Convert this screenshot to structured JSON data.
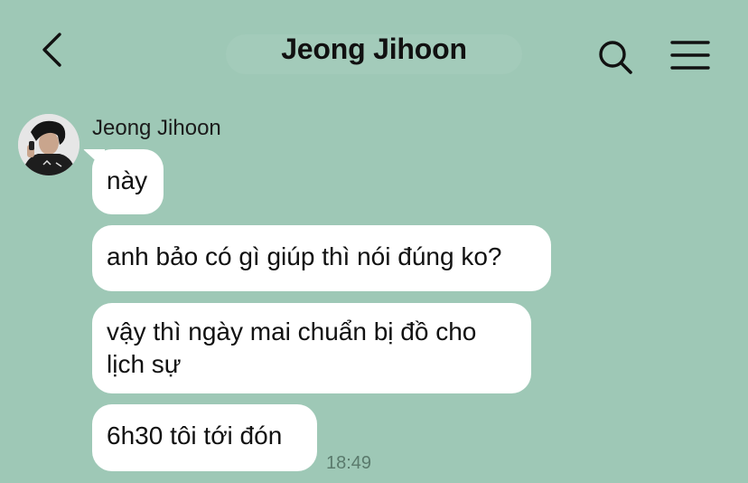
{
  "header": {
    "title": "Jeong Jihoon",
    "back_icon": "chevron-left-icon",
    "search_icon": "search-icon",
    "menu_icon": "hamburger-menu-icon"
  },
  "chat": {
    "sender_name": "Jeong Jihoon",
    "messages": [
      {
        "text": "này"
      },
      {
        "text": "anh bảo có gì giúp thì nói đúng ko?"
      },
      {
        "text": "vậy thì ngày mai chuẩn bị đồ cho lịch sự"
      },
      {
        "text": "6h30 tôi tới đón"
      }
    ],
    "last_time": "18:49"
  },
  "colors": {
    "background": "#9ec8b6",
    "bubble": "#ffffff",
    "text": "#111111",
    "timestamp": "#5a7a6c"
  }
}
